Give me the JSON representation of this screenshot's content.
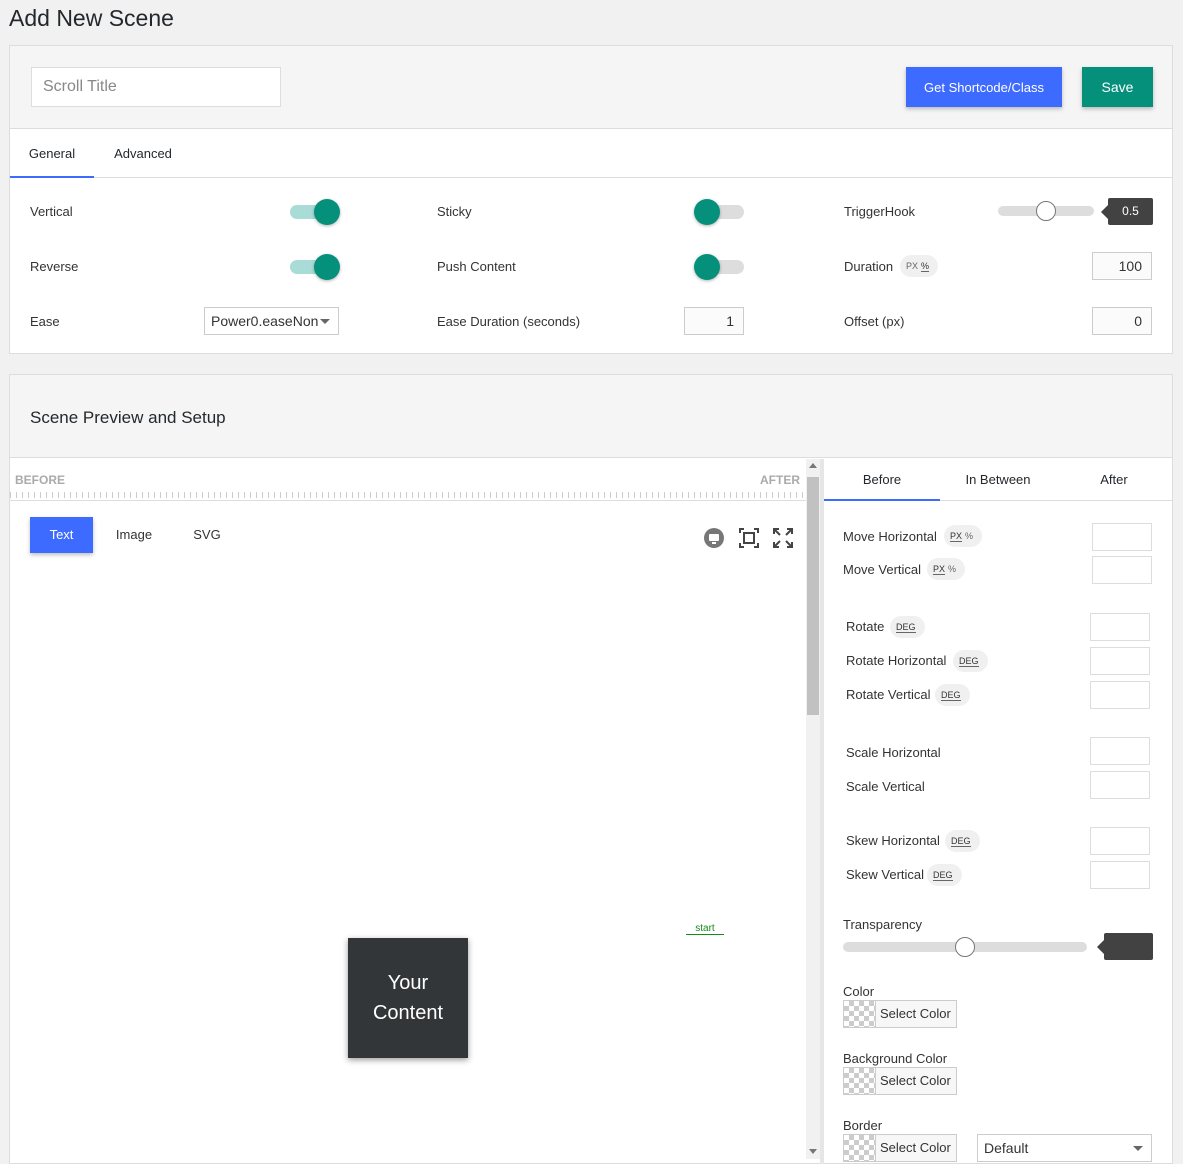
{
  "page": {
    "title": "Add New Scene"
  },
  "header": {
    "title_placeholder": "Scroll Title",
    "shortcode_label": "Get Shortcode/Class",
    "save_label": "Save"
  },
  "tabs": [
    {
      "label": "General",
      "active": true
    },
    {
      "label": "Advanced",
      "active": false
    }
  ],
  "general": {
    "vertical": {
      "label": "Vertical",
      "on": true
    },
    "reverse": {
      "label": "Reverse",
      "on": true
    },
    "ease": {
      "label": "Ease",
      "value": "Power0.easeNon"
    },
    "sticky": {
      "label": "Sticky",
      "on": false
    },
    "push_content": {
      "label": "Push Content",
      "on": false
    },
    "ease_duration": {
      "label": "Ease Duration (seconds)",
      "value": "1"
    },
    "trigger_hook": {
      "label": "TriggerHook",
      "value": "0.5",
      "level": 0.5
    },
    "duration": {
      "label": "Duration",
      "value": "100",
      "units": [
        "PX",
        "%"
      ]
    },
    "offset": {
      "label": "Offset (px)",
      "value": "0"
    }
  },
  "preview": {
    "title": "Scene Preview and Setup",
    "ruler_before": "BEFORE",
    "ruler_after": "AFTER",
    "content_tabs": [
      {
        "label": "Text",
        "active": true
      },
      {
        "label": "Image",
        "active": false
      },
      {
        "label": "SVG",
        "active": false
      }
    ],
    "content_line1": "Your",
    "content_line2": "Content",
    "start_label": "start"
  },
  "state_tabs": [
    {
      "label": "Before",
      "active": true
    },
    {
      "label": "In Between",
      "active": false
    },
    {
      "label": "After",
      "active": false
    }
  ],
  "props": {
    "move_horizontal": {
      "label": "Move Horizontal",
      "units": [
        "PX",
        "%"
      ]
    },
    "move_vertical": {
      "label": "Move Vertical",
      "units": [
        "PX",
        "%"
      ]
    },
    "rotate": {
      "label": "Rotate",
      "unit": "DEG"
    },
    "rotate_horizontal": {
      "label": "Rotate Horizontal",
      "unit": "DEG"
    },
    "rotate_vertical": {
      "label": "Rotate Vertical",
      "unit": "DEG"
    },
    "scale_horizontal": {
      "label": "Scale Horizontal"
    },
    "scale_vertical": {
      "label": "Scale Vertical"
    },
    "skew_horizontal": {
      "label": "Skew Horizontal",
      "unit": "DEG"
    },
    "skew_vertical": {
      "label": "Skew Vertical",
      "unit": "DEG"
    },
    "transparency": {
      "label": "Transparency",
      "level": 0.5
    },
    "color": {
      "label": "Color",
      "button": "Select Color"
    },
    "background_color": {
      "label": "Background Color",
      "button": "Select Color"
    },
    "border": {
      "label": "Border",
      "button": "Select Color",
      "style": "Default"
    }
  },
  "colors": {
    "accent_blue": "#3d6bff",
    "accent_green": "#05907b",
    "dark_box": "#333639"
  }
}
